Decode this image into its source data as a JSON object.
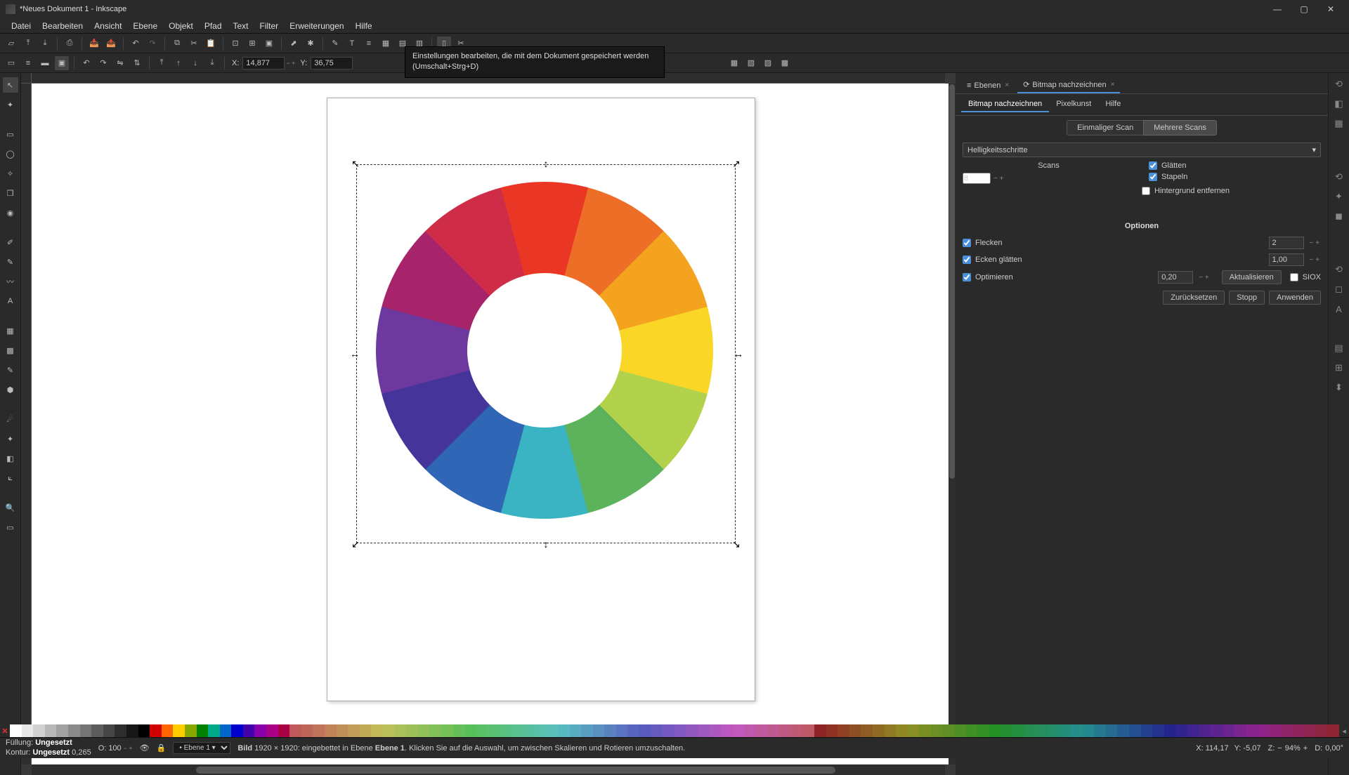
{
  "title": "*Neues Dokument 1 - Inkscape",
  "menu": [
    "Datei",
    "Bearbeiten",
    "Ansicht",
    "Ebene",
    "Objekt",
    "Pfad",
    "Text",
    "Filter",
    "Erweiterungen",
    "Hilfe"
  ],
  "tooltip": "Einstellungen bearbeiten, die mit dem Dokument gespeichert werden (Umschalt+Strg+D)",
  "coords": {
    "xlabel": "X:",
    "x": "14,877",
    "ylabel": "Y:",
    "y": "36,75"
  },
  "panel": {
    "tabs": [
      {
        "icon": "≡",
        "label": "Ebenen",
        "close": "×"
      },
      {
        "icon": "⟳",
        "label": "Bitmap nachzeichnen",
        "close": "×"
      }
    ],
    "subtabs": [
      "Bitmap nachzeichnen",
      "Pixelkunst",
      "Hilfe"
    ],
    "scanmodes": [
      "Einmaliger Scan",
      "Mehrere Scans"
    ],
    "dropdown": "Helligkeitsschritte",
    "scans_label": "Scans",
    "scans_value": "8",
    "glaetten": "Glätten",
    "stapeln": "Stapeln",
    "hintergrund": "Hintergrund entfernen",
    "options_hdr": "Optionen",
    "opts": [
      {
        "label": "Flecken",
        "value": "2"
      },
      {
        "label": "Ecken glätten",
        "value": "1,00"
      },
      {
        "label": "Optimieren",
        "value": "0,20"
      }
    ],
    "update": "Aktualisieren",
    "siox": "SIOX",
    "reset": "Zurücksetzen",
    "stop": "Stopp",
    "apply": "Anwenden"
  },
  "status": {
    "fill_label": "Füllung:",
    "fill": "Ungesetzt",
    "stroke_label": "Kontur:",
    "stroke": "Ungesetzt",
    "stroke_w": "0,265",
    "opacity_label": "O:",
    "opacity": "100",
    "layer": "Ebene 1",
    "obj_type": "Bild",
    "obj_info": "1920 × 1920: eingebettet in Ebene",
    "obj_layer": "Ebene 1",
    "hint": ". Klicken Sie auf die Auswahl, um zwischen Skalieren und Rotieren umzuschalten.",
    "x_label": "X:",
    "x": "114,17",
    "y_label": "Y:",
    "y": "-5,07",
    "z_label": "Z:",
    "zoom": "94%",
    "d_label": "D:",
    "d": "0,00°"
  },
  "wheel_colors": [
    "#ea3624",
    "#ed6e27",
    "#f4a31e",
    "#fad727",
    "#b1d24a",
    "#5db35c",
    "#3ab3c2",
    "#3066b6",
    "#45349a",
    "#6e399e",
    "#a7236a",
    "#cf2d47"
  ]
}
